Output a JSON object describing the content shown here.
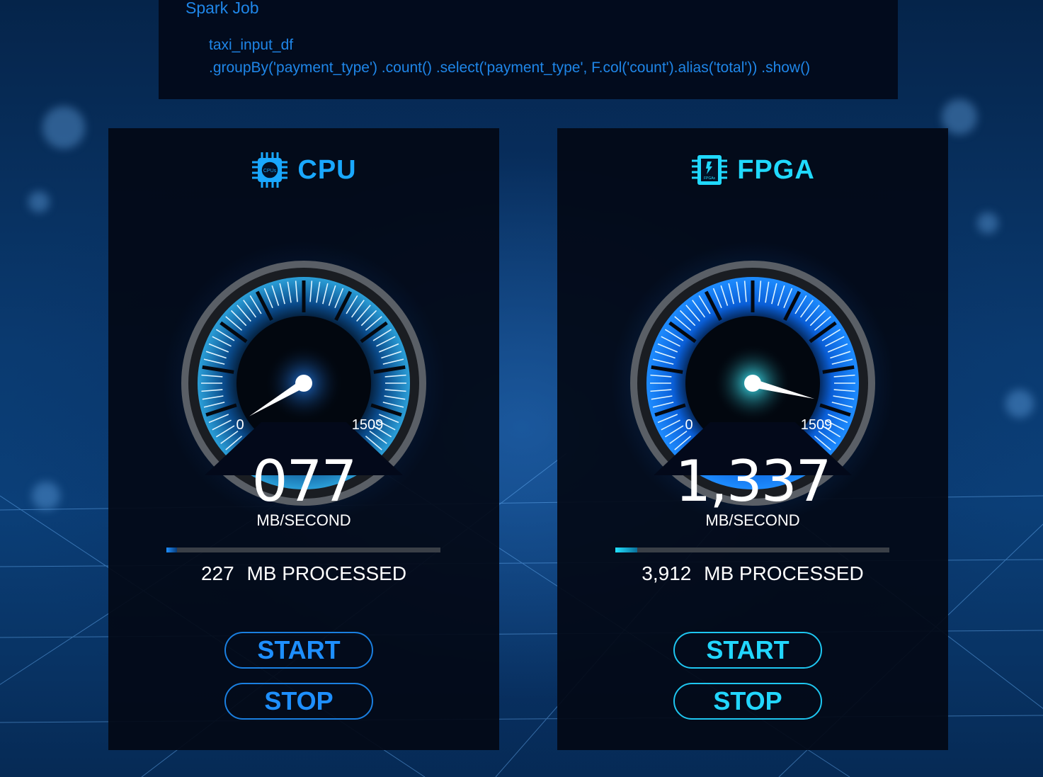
{
  "code": {
    "title": "Spark Job",
    "lines": [
      "taxi_input_df",
      ".groupBy('payment_type') .count() .select('payment_type', F.col('count').alias('total')) .show()"
    ]
  },
  "cpu": {
    "title": "CPU",
    "chip_label": "CPUs",
    "gauge": {
      "min_label": "0",
      "max_label": "1509",
      "min": 0,
      "max": 1509,
      "value": 77
    },
    "speed": "077",
    "unit": "MB/SECOND",
    "progress": 0.04,
    "processed_value": "227",
    "processed_label": "MB PROCESSED",
    "start_label": "START",
    "stop_label": "STOP",
    "accent": "#1e8fff"
  },
  "fpga": {
    "title": "FPGA",
    "chip_label": "FPGAs",
    "gauge": {
      "min_label": "0",
      "max_label": "1509",
      "min": 0,
      "max": 1509,
      "value": 1337
    },
    "speed": "1,337",
    "unit": "MB/SECOND",
    "progress": 0.08,
    "processed_value": "3,912",
    "processed_label": "MB PROCESSED",
    "start_label": "START",
    "stop_label": "STOP",
    "accent": "#22d6ff"
  }
}
